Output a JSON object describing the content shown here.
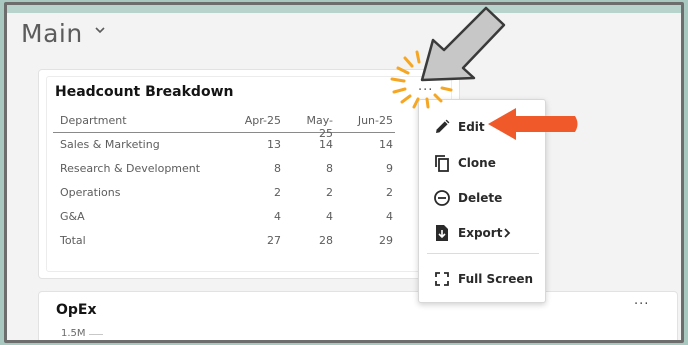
{
  "page": {
    "title": "Main"
  },
  "headcount_card": {
    "title": "Headcount Breakdown",
    "menu_icon": "more-horizontal-icon",
    "table": {
      "columns": [
        "Department",
        "Apr-25",
        "May-25",
        "Jun-25"
      ],
      "rows": [
        [
          "Sales & Marketing",
          "13",
          "14",
          "14"
        ],
        [
          "Research & Development",
          "8",
          "8",
          "9"
        ],
        [
          "Operations",
          "2",
          "2",
          "2"
        ],
        [
          "G&A",
          "4",
          "4",
          "4"
        ],
        [
          "Total",
          "27",
          "28",
          "29"
        ]
      ]
    }
  },
  "context_menu": {
    "items": [
      {
        "label": "Edit",
        "icon": "pencil-icon"
      },
      {
        "label": "Clone",
        "icon": "copy-icon"
      },
      {
        "label": "Delete",
        "icon": "minus-circle-icon"
      },
      {
        "label": "Export",
        "icon": "export-file-icon",
        "has_submenu": true
      },
      {
        "label": "Full Screen",
        "icon": "fullscreen-icon"
      }
    ]
  },
  "opex_card": {
    "title": "OpEx",
    "menu_icon": "more-horizontal-icon",
    "y_tick": "1.5M"
  },
  "colors": {
    "frame_border": "#6d6d6d",
    "background": "#a9c8bf",
    "callout_arrow": "#f05a2a",
    "highlight_rays": "#f5a623",
    "pointer_arrow": "#c7c7c7"
  }
}
